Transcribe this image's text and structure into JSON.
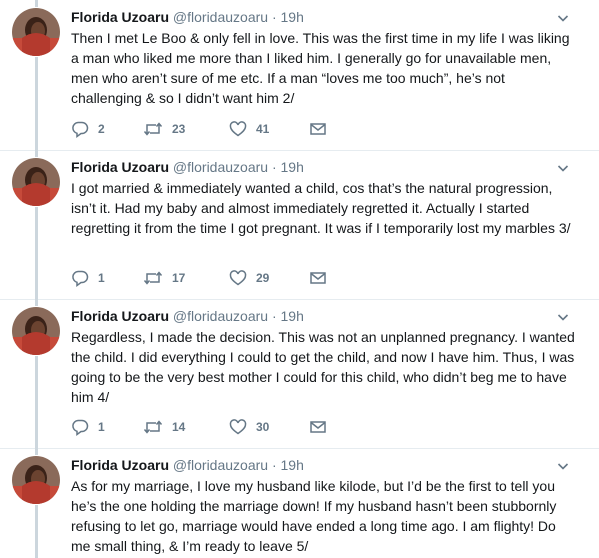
{
  "tweets": [
    {
      "name": "Florida Uzoaru",
      "handle": "@floridauzoaru",
      "dot": "·",
      "time": "19h",
      "text": "Then I met Le Boo & only fell in love. This was the first time in my life I was liking a man who liked me more than I liked him. I generally go for unavailable men, men who aren’t sure of me etc. If a man “loves me too much”, he’s not challenging & so I didn’t want him 2/",
      "replies": "2",
      "retweets": "23",
      "likes": "41"
    },
    {
      "name": "Florida Uzoaru",
      "handle": "@floridauzoaru",
      "dot": "·",
      "time": "19h",
      "text": "I got married & immediately wanted a child, cos that’s the natural progression, isn’t it. Had my baby and almost immediately regretted it. Actually I started regretting it from the time I got pregnant. It was if I temporarily lost my marbles 3/",
      "replies": "1",
      "retweets": "17",
      "likes": "29"
    },
    {
      "name": "Florida Uzoaru",
      "handle": "@floridauzoaru",
      "dot": "·",
      "time": "19h",
      "text": "Regardless, I made the decision. This was not an unplanned pregnancy. I wanted the child. I did everything I could to get the child, and now I have him. Thus, I was going to be the very best mother I could for this child, who didn’t beg me to have him 4/",
      "replies": "1",
      "retweets": "14",
      "likes": "30"
    },
    {
      "name": "Florida Uzoaru",
      "handle": "@floridauzoaru",
      "dot": "·",
      "time": "19h",
      "text": "As for my marriage, I love my husband like kilode, but I’d be the first to tell you he’s the one holding the marriage down! If my husband hasn’t been stubbornly refusing to let go, marriage would have ended a long time ago. I am flighty! Do me small thing, & I’m ready to leave 5/"
    }
  ],
  "icons": {
    "reply": "reply-icon",
    "retweet": "retweet-icon",
    "like": "heart-icon",
    "message": "direct-message-icon",
    "more": "chevron-down-icon"
  },
  "colors": {
    "text": "#14171a",
    "secondary": "#657786",
    "thread_line": "#ccd6dd",
    "divider": "#e6ecf0"
  }
}
